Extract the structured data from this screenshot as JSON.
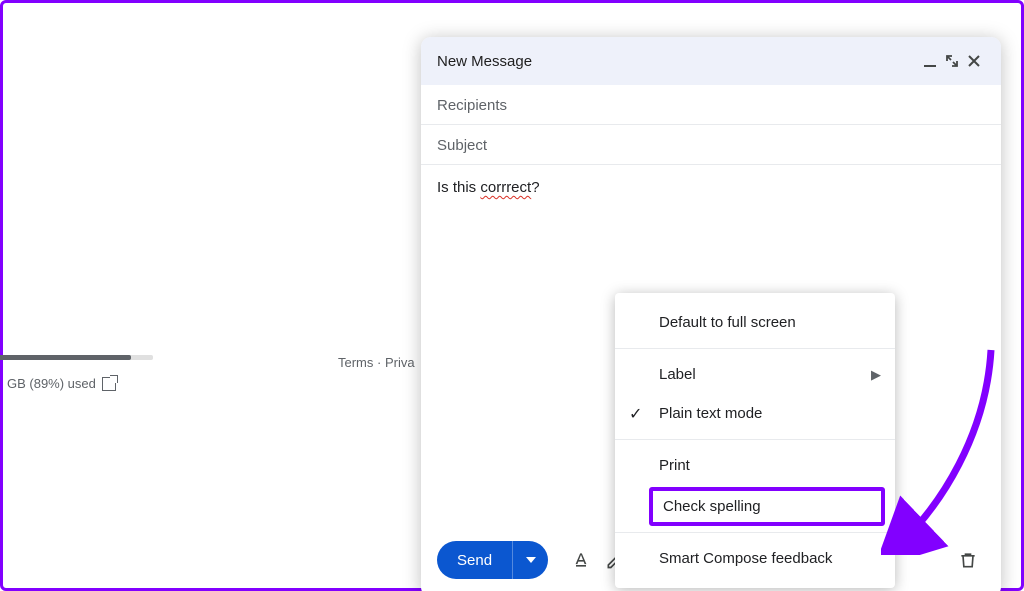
{
  "storage": {
    "percent": 89,
    "text": "GB (89%) used"
  },
  "footer": {
    "links": "Terms · Priva"
  },
  "compose": {
    "title": "New Message",
    "recipients_placeholder": "Recipients",
    "subject_placeholder": "Subject",
    "body_prefix": "Is this ",
    "body_misspelled": "corrrect",
    "body_suffix": "?",
    "send_label": "Send"
  },
  "menu": {
    "default_full": "Default to full screen",
    "label": "Label",
    "plain_text": "Plain text mode",
    "print": "Print",
    "check_spelling": "Check spelling",
    "smart_compose": "Smart Compose feedback"
  }
}
